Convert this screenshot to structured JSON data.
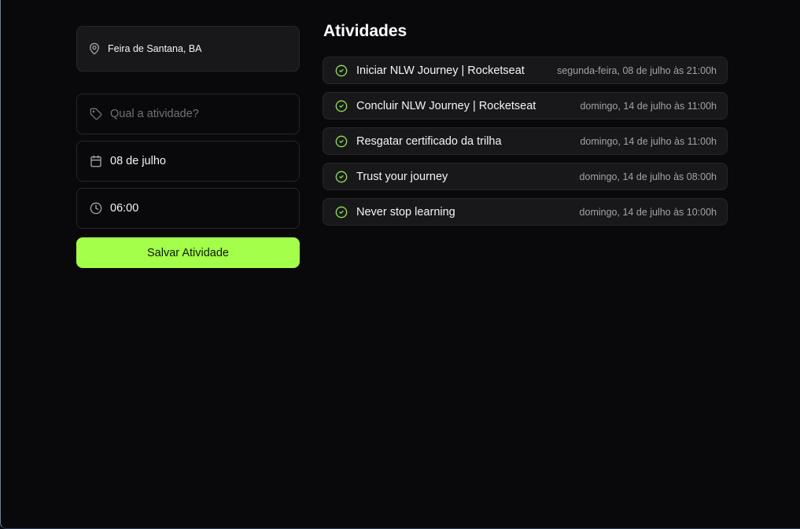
{
  "location": {
    "text": "Feira de Santana, BA",
    "icon": "map-pin-icon"
  },
  "form": {
    "activity_placeholder": "Qual a atividade?",
    "activity_icon": "tag-icon",
    "date_value": "08 de julho",
    "date_icon": "calendar-icon",
    "time_value": "06:00",
    "time_icon": "clock-icon",
    "save_label": "Salvar Atividade"
  },
  "activities": {
    "title": "Atividades",
    "items": [
      {
        "name": "Iniciar NLW Journey | Rocketseat",
        "when": "segunda-feira, 08 de julho às 21:00h"
      },
      {
        "name": "Concluir NLW Journey | Rocketseat",
        "when": "domingo, 14 de julho às 11:00h"
      },
      {
        "name": "Resgatar certificado da trilha",
        "when": "domingo, 14 de julho às 11:00h"
      },
      {
        "name": "Trust your journey",
        "when": "domingo, 14 de julho às 08:00h"
      },
      {
        "name": "Never stop learning",
        "when": "domingo, 14 de julho às 10:00h"
      }
    ]
  },
  "colors": {
    "background": "#09090b",
    "card": "#18181b",
    "border": "#27272a",
    "accent": "#a3ff4a",
    "check": "#8fe34a",
    "muted_text": "#a1a1aa"
  }
}
